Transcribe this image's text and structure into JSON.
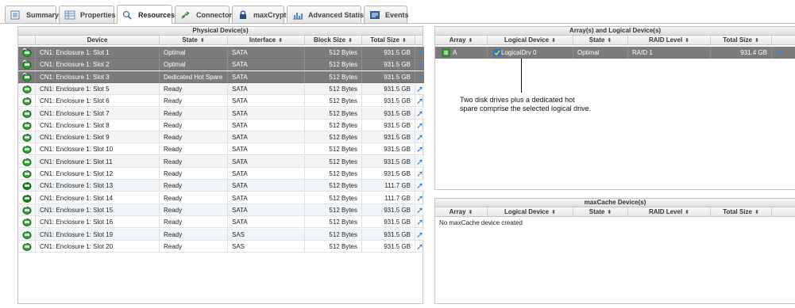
{
  "tabs": [
    {
      "label": "Summary",
      "icon": "list-icon",
      "active": false
    },
    {
      "label": "Properties",
      "icon": "properties-grid-icon",
      "active": false
    },
    {
      "label": "Resources",
      "icon": "magnifier-icon",
      "active": true
    },
    {
      "label": "Connectors",
      "icon": "plug-icon",
      "active": false
    },
    {
      "label": "maxCrypto",
      "icon": "padlock-icon",
      "active": false
    },
    {
      "label": "Advanced Statistics",
      "icon": "bar-chart-icon",
      "active": false
    },
    {
      "label": "Events",
      "icon": "event-log-icon",
      "active": false
    }
  ],
  "physical": {
    "title": "Physical Device(s)",
    "columns": [
      "",
      "Device",
      "State",
      "Interface",
      "Block Size",
      "Total Size",
      ""
    ],
    "rows": [
      {
        "device": "CN1: Enclosure 1: Slot 1",
        "state": "Optimal",
        "interface": "SATA",
        "block": "512 Bytes",
        "total": "931.5 GB",
        "selected": true
      },
      {
        "device": "CN1: Enclosure 1: Slot 2",
        "state": "Optimal",
        "interface": "SATA",
        "block": "512 Bytes",
        "total": "931.5 GB",
        "selected": true
      },
      {
        "device": "CN1: Enclosure 1: Slot 3",
        "state": "Dedicated Hot Spare",
        "interface": "SATA",
        "block": "512 Bytes",
        "total": "931.5 GB",
        "selected": true
      },
      {
        "device": "CN1: Enclosure 1: Slot 5",
        "state": "Ready",
        "interface": "SATA",
        "block": "512 Bytes",
        "total": "931.5 GB",
        "selected": false
      },
      {
        "device": "CN1: Enclosure 1: Slot 6",
        "state": "Ready",
        "interface": "SATA",
        "block": "512 Bytes",
        "total": "931.5 GB",
        "selected": false
      },
      {
        "device": "CN1: Enclosure 1: Slot 7",
        "state": "Ready",
        "interface": "SATA",
        "block": "512 Bytes",
        "total": "931.5 GB",
        "selected": false
      },
      {
        "device": "CN1: Enclosure 1: Slot 8",
        "state": "Ready",
        "interface": "SATA",
        "block": "512 Bytes",
        "total": "931.5 GB",
        "selected": false
      },
      {
        "device": "CN1: Enclosure 1: Slot 9",
        "state": "Ready",
        "interface": "SATA",
        "block": "512 Bytes",
        "total": "931.5 GB",
        "selected": false
      },
      {
        "device": "CN1: Enclosure 1: Slot 10",
        "state": "Ready",
        "interface": "SATA",
        "block": "512 Bytes",
        "total": "931.5 GB",
        "selected": false
      },
      {
        "device": "CN1: Enclosure 1: Slot 11",
        "state": "Ready",
        "interface": "SATA",
        "block": "512 Bytes",
        "total": "931.5 GB",
        "selected": false
      },
      {
        "device": "CN1: Enclosure 1: Slot 12",
        "state": "Ready",
        "interface": "SATA",
        "block": "512 Bytes",
        "total": "931.5 GB",
        "selected": false
      },
      {
        "device": "CN1: Enclosure 1: Slot 13",
        "state": "Ready",
        "interface": "SATA",
        "block": "512 Bytes",
        "total": "111.7 GB",
        "selected": false
      },
      {
        "device": "CN1: Enclosure 1: Slot 14",
        "state": "Ready",
        "interface": "SATA",
        "block": "512 Bytes",
        "total": "111.7 GB",
        "selected": false
      },
      {
        "device": "CN1: Enclosure 1: Slot 15",
        "state": "Ready",
        "interface": "SATA",
        "block": "512 Bytes",
        "total": "931.5 GB",
        "selected": false
      },
      {
        "device": "CN1: Enclosure 1: Slot 16",
        "state": "Ready",
        "interface": "SATA",
        "block": "512 Bytes",
        "total": "931.5 GB",
        "selected": false
      },
      {
        "device": "CN1: Enclosure 1: Slot 19",
        "state": "Ready",
        "interface": "SAS",
        "block": "512 Bytes",
        "total": "931.5 GB",
        "selected": false
      },
      {
        "device": "CN1: Enclosure 1: Slot 20",
        "state": "Ready",
        "interface": "SAS",
        "block": "512 Bytes",
        "total": "931.5 GB",
        "selected": false
      }
    ]
  },
  "arrays": {
    "title": "Array(s) and Logical Device(s)",
    "columns": [
      "Array",
      "Logical Device",
      "State",
      "RAID Level",
      "Total Size",
      ""
    ],
    "rows": [
      {
        "array": "A",
        "logical": "LogicalDrv 0",
        "state": "Optimal",
        "raid": "RAID 1",
        "total": "931.4 GB",
        "selected": true
      }
    ]
  },
  "annotation": {
    "line1": "Two disk drives plus a dedicated hot",
    "line2": "spare comprise the selected logical drive."
  },
  "maxcache": {
    "title": "maxCache Device(s)",
    "columns": [
      "Array",
      "Logical Device",
      "State",
      "RAID Level",
      "Total Size",
      ""
    ],
    "empty_text": "No maxCache device created"
  },
  "colors": {
    "selected_row": "#7c7c7c",
    "alt_row": "#f2f5f8",
    "link_arrow": "#2f78c8",
    "drive_icon_green": "#3aa53a"
  }
}
